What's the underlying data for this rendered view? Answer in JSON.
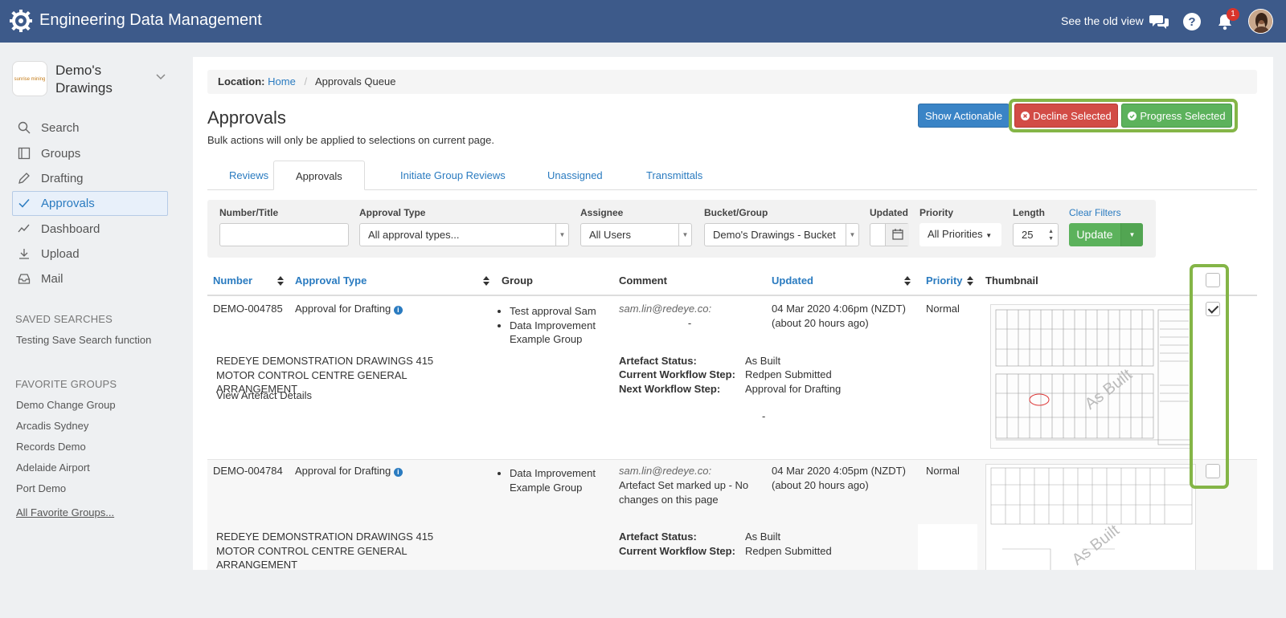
{
  "topbar": {
    "title": "Engineering Data Management",
    "old_view": "See the old view",
    "notification_count": "1",
    "icons": [
      "gear-logo-icon",
      "chat-icon",
      "help-icon",
      "bell-icon",
      "avatar"
    ]
  },
  "sidebar": {
    "org_logo_text": "sunrise mining",
    "org_name": "Demo's Drawings",
    "nav": [
      {
        "label": "Search",
        "icon": "search-icon"
      },
      {
        "label": "Groups",
        "icon": "book-icon"
      },
      {
        "label": "Drafting",
        "icon": "pencil-icon"
      },
      {
        "label": "Approvals",
        "icon": "check-icon",
        "active": true
      },
      {
        "label": "Dashboard",
        "icon": "line-chart-icon"
      },
      {
        "label": "Upload",
        "icon": "upload-icon"
      },
      {
        "label": "Mail",
        "icon": "inbox-icon"
      }
    ],
    "saved_searches_heading": "SAVED SEARCHES",
    "saved_searches": [
      "Testing Save Search function"
    ],
    "favorite_groups_heading": "FAVORITE GROUPS",
    "favorite_groups": [
      "Demo Change Group",
      "Arcadis Sydney",
      "Records Demo",
      "Adelaide Airport",
      "Port Demo"
    ],
    "all_favorites": "All Favorite Groups..."
  },
  "breadcrumb": {
    "label": "Location:",
    "home": "Home",
    "current": "Approvals Queue"
  },
  "page": {
    "title": "Approvals",
    "note": "Bulk actions will only be applied to selections on current page.",
    "show_actionable": "Show Actionable",
    "decline_selected": "Decline Selected",
    "progress_selected": "Progress Selected"
  },
  "tabs": [
    "Reviews",
    "Approvals",
    "Initiate Group Reviews",
    "Unassigned",
    "Transmittals"
  ],
  "active_tab": "Approvals",
  "filters": {
    "number_title": {
      "label": "Number/Title",
      "value": ""
    },
    "approval_type": {
      "label": "Approval Type",
      "value": "All approval types..."
    },
    "assignee": {
      "label": "Assignee",
      "value": "All Users"
    },
    "bucket_group": {
      "label": "Bucket/Group",
      "value": "Demo's Drawings - Bucket"
    },
    "updated": {
      "label": "Updated",
      "value": ""
    },
    "priority": {
      "label": "Priority",
      "value": "All Priorities"
    },
    "length": {
      "label": "Length",
      "value": "25"
    },
    "clear": "Clear Filters",
    "update": "Update"
  },
  "table": {
    "columns": [
      "Number",
      "Approval Type",
      "Group",
      "Comment",
      "Updated",
      "Priority",
      "Thumbnail"
    ],
    "rows": [
      {
        "number": "DEMO-004785",
        "approval_type": "Approval for Drafting",
        "groups": [
          "Test approval Sam",
          "Data Improvement Example Group"
        ],
        "comment_author": "sam.lin@redeye.co:",
        "comment_text": "-",
        "updated": "04 Mar 2020 4:06pm (NZDT)",
        "updated_relative": "(about 20 hours ago)",
        "priority": "Normal",
        "title": "REDEYE DEMONSTRATION DRAWINGS 415 MOTOR CONTROL CENTRE GENERAL ARRANGEMENT",
        "details_link": "View Artefact Details",
        "artefact_status_label": "Artefact Status:",
        "artefact_status": "As Built",
        "current_step_label": "Current Workflow Step:",
        "current_step": "Redpen Submitted",
        "next_step_label": "Next Workflow Step:",
        "next_step": "Approval for Drafting",
        "extra": "-",
        "thumb_watermark": "As Built",
        "checked": true
      },
      {
        "number": "DEMO-004784",
        "approval_type": "Approval for Drafting",
        "groups": [
          "Data Improvement Example Group"
        ],
        "comment_author": "sam.lin@redeye.co:",
        "comment_text": "Artefact Set marked up - No changes on this page",
        "updated": "04 Mar 2020 4:05pm (NZDT)",
        "updated_relative": "(about 20 hours ago)",
        "priority": "Normal",
        "title": "REDEYE DEMONSTRATION DRAWINGS 415 MOTOR CONTROL CENTRE GENERAL ARRANGEMENT",
        "artefact_status_label": "Artefact Status:",
        "artefact_status": "As Built",
        "current_step_label": "Current Workflow Step:",
        "current_step": "Redpen Submitted",
        "thumb_watermark": "As Built",
        "checked": false
      }
    ]
  },
  "colors": {
    "topbar": "#3d5a8a",
    "link": "#2a7bc0",
    "highlight": "#84b547",
    "decline": "#d24c46",
    "progress": "#5cb25c"
  }
}
